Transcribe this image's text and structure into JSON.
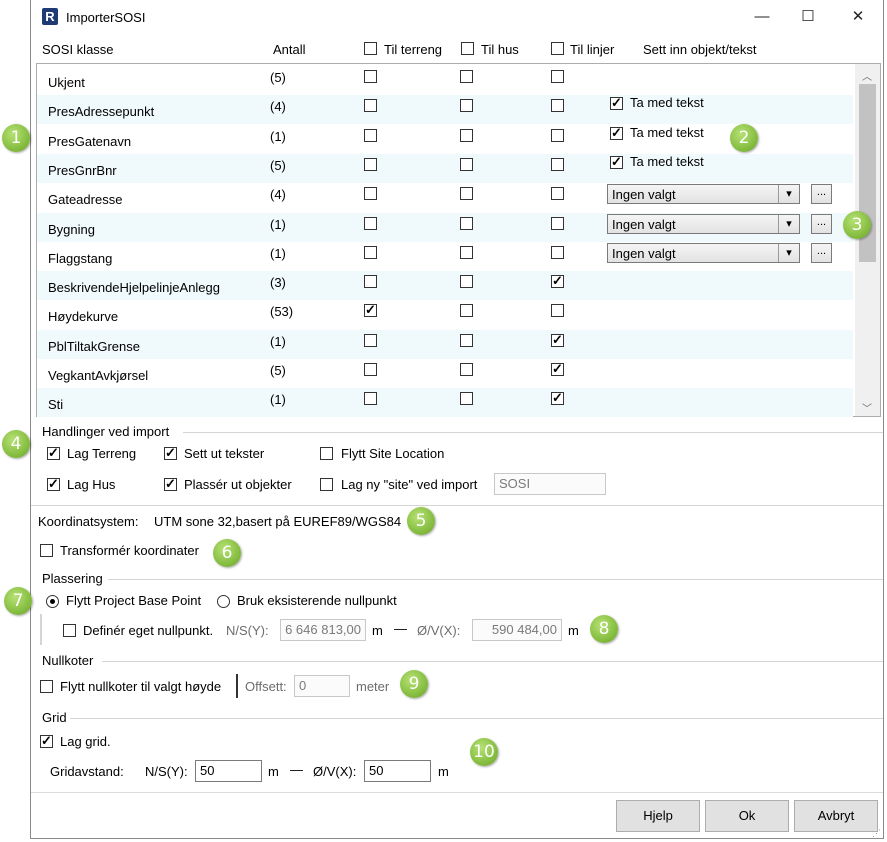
{
  "window": {
    "title": "ImporterSOSI",
    "app_icon_letter": "R",
    "minimize": "—",
    "maximize": "☐",
    "close": "✕"
  },
  "columns": {
    "klasse": "SOSI klasse",
    "antall": "Antall",
    "terreng": "Til terreng",
    "hus": "Til hus",
    "linjer": "Til linjer",
    "sett_inn": "Sett inn objekt/tekst"
  },
  "rows": [
    {
      "name": "Ukjent",
      "count": "(5)",
      "terreng": false,
      "hus": false,
      "linjer": false,
      "extra": "none"
    },
    {
      "name": "PresAdressepunkt",
      "count": "(4)",
      "terreng": false,
      "hus": false,
      "linjer": false,
      "extra": "text"
    },
    {
      "name": "PresGatenavn",
      "count": "(1)",
      "terreng": false,
      "hus": false,
      "linjer": false,
      "extra": "text"
    },
    {
      "name": "PresGnrBnr",
      "count": "(5)",
      "terreng": false,
      "hus": false,
      "linjer": false,
      "extra": "text"
    },
    {
      "name": "Gateadresse",
      "count": "(4)",
      "terreng": false,
      "hus": false,
      "linjer": false,
      "extra": "combo"
    },
    {
      "name": "Bygning",
      "count": "(1)",
      "terreng": false,
      "hus": false,
      "linjer": false,
      "extra": "combo"
    },
    {
      "name": "Flaggstang",
      "count": "(1)",
      "terreng": false,
      "hus": false,
      "linjer": false,
      "extra": "combo"
    },
    {
      "name": "BeskrivendeHjelpelinjeAnlegg",
      "count": "(3)",
      "terreng": false,
      "hus": false,
      "linjer": true,
      "extra": "none"
    },
    {
      "name": "Høydekurve",
      "count": "(53)",
      "terreng": true,
      "hus": false,
      "linjer": false,
      "extra": "none"
    },
    {
      "name": "PblTiltakGrense",
      "count": "(1)",
      "terreng": false,
      "hus": false,
      "linjer": true,
      "extra": "none"
    },
    {
      "name": "VegkantAvkjørsel",
      "count": "(5)",
      "terreng": false,
      "hus": false,
      "linjer": true,
      "extra": "none"
    },
    {
      "name": "Sti",
      "count": "(1)",
      "terreng": false,
      "hus": false,
      "linjer": true,
      "extra": "none"
    }
  ],
  "ta_med_tekst": "Ta med tekst",
  "ingen_valgt": "Ingen valgt",
  "dots": "...",
  "handlinger": {
    "title": "Handlinger ved import",
    "lag_terreng": "Lag Terreng",
    "sett_ut_tekster": "Sett ut tekster",
    "flytt_site": "Flytt Site Location",
    "lag_hus": "Lag Hus",
    "plasser_objekter": "Plassér ut objekter",
    "lag_ny_site": "Lag ny \"site\" ved import",
    "site_name": "SOSI"
  },
  "koordinat": {
    "label": "Koordinatsystem:",
    "value": "UTM sone 32,basert på EUREF89/WGS84",
    "transformer": "Transformér koordinater"
  },
  "plassering": {
    "title": "Plassering",
    "flytt_pbp": "Flytt Project Base Point",
    "bruk_eksisterende": "Bruk eksisterende nullpunkt",
    "definer": "Definér eget nullpunkt.",
    "ns_label": "N/S(Y):",
    "ns_value": "6 646 813,00",
    "ow_label": "Ø/V(X):",
    "ow_value": "590 484,00",
    "unit": "m",
    "dash": "—"
  },
  "nullkoter": {
    "title": "Nullkoter",
    "flytt": "Flytt nullkoter til valgt høyde",
    "offsett_label": "Offsett:",
    "offsett_value": "0",
    "unit": "meter"
  },
  "grid": {
    "title": "Grid",
    "lag_grid": "Lag grid.",
    "gridavstand": "Gridavstand:",
    "ns_label": "N/S(Y):",
    "ns_value": "50",
    "ow_label": "Ø/V(X):",
    "ow_value": "50",
    "unit": "m",
    "dash": "—"
  },
  "buttons": {
    "hjelp": "Hjelp",
    "ok": "Ok",
    "avbryt": "Avbryt"
  },
  "badges": [
    "1",
    "2",
    "3",
    "4",
    "5",
    "6",
    "7",
    "8",
    "9",
    "10"
  ],
  "colors": {
    "accent_green": "#7fb83a",
    "alt_row": "#f0fafd"
  }
}
